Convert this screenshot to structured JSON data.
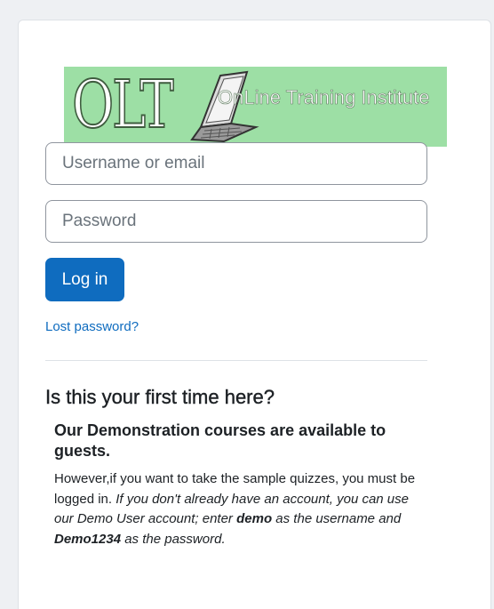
{
  "logo": {
    "letters": "OLT",
    "subtitle": "OnLine Training Institute",
    "background": "#9ddfa5"
  },
  "login_form": {
    "username_placeholder": "Username or email",
    "password_placeholder": "Password",
    "login_label": "Log in",
    "lost_password_label": "Lost password?"
  },
  "info": {
    "heading": "Is this your first time here?",
    "subheading": "Our Demonstration courses are available to guests.",
    "text_intro": "However,if you want to take the sample quizzes, you must be logged in.",
    "text_italic_a": "If you don't already have an account, you can use our Demo User account; enter",
    "demo_username": "demo",
    "text_italic_b": "as the username and",
    "demo_password": "Demo1234",
    "text_italic_c": "as the password."
  },
  "colors": {
    "primary": "#0f6cbf",
    "card_border": "#dee2e6",
    "text": "#1d2125"
  }
}
